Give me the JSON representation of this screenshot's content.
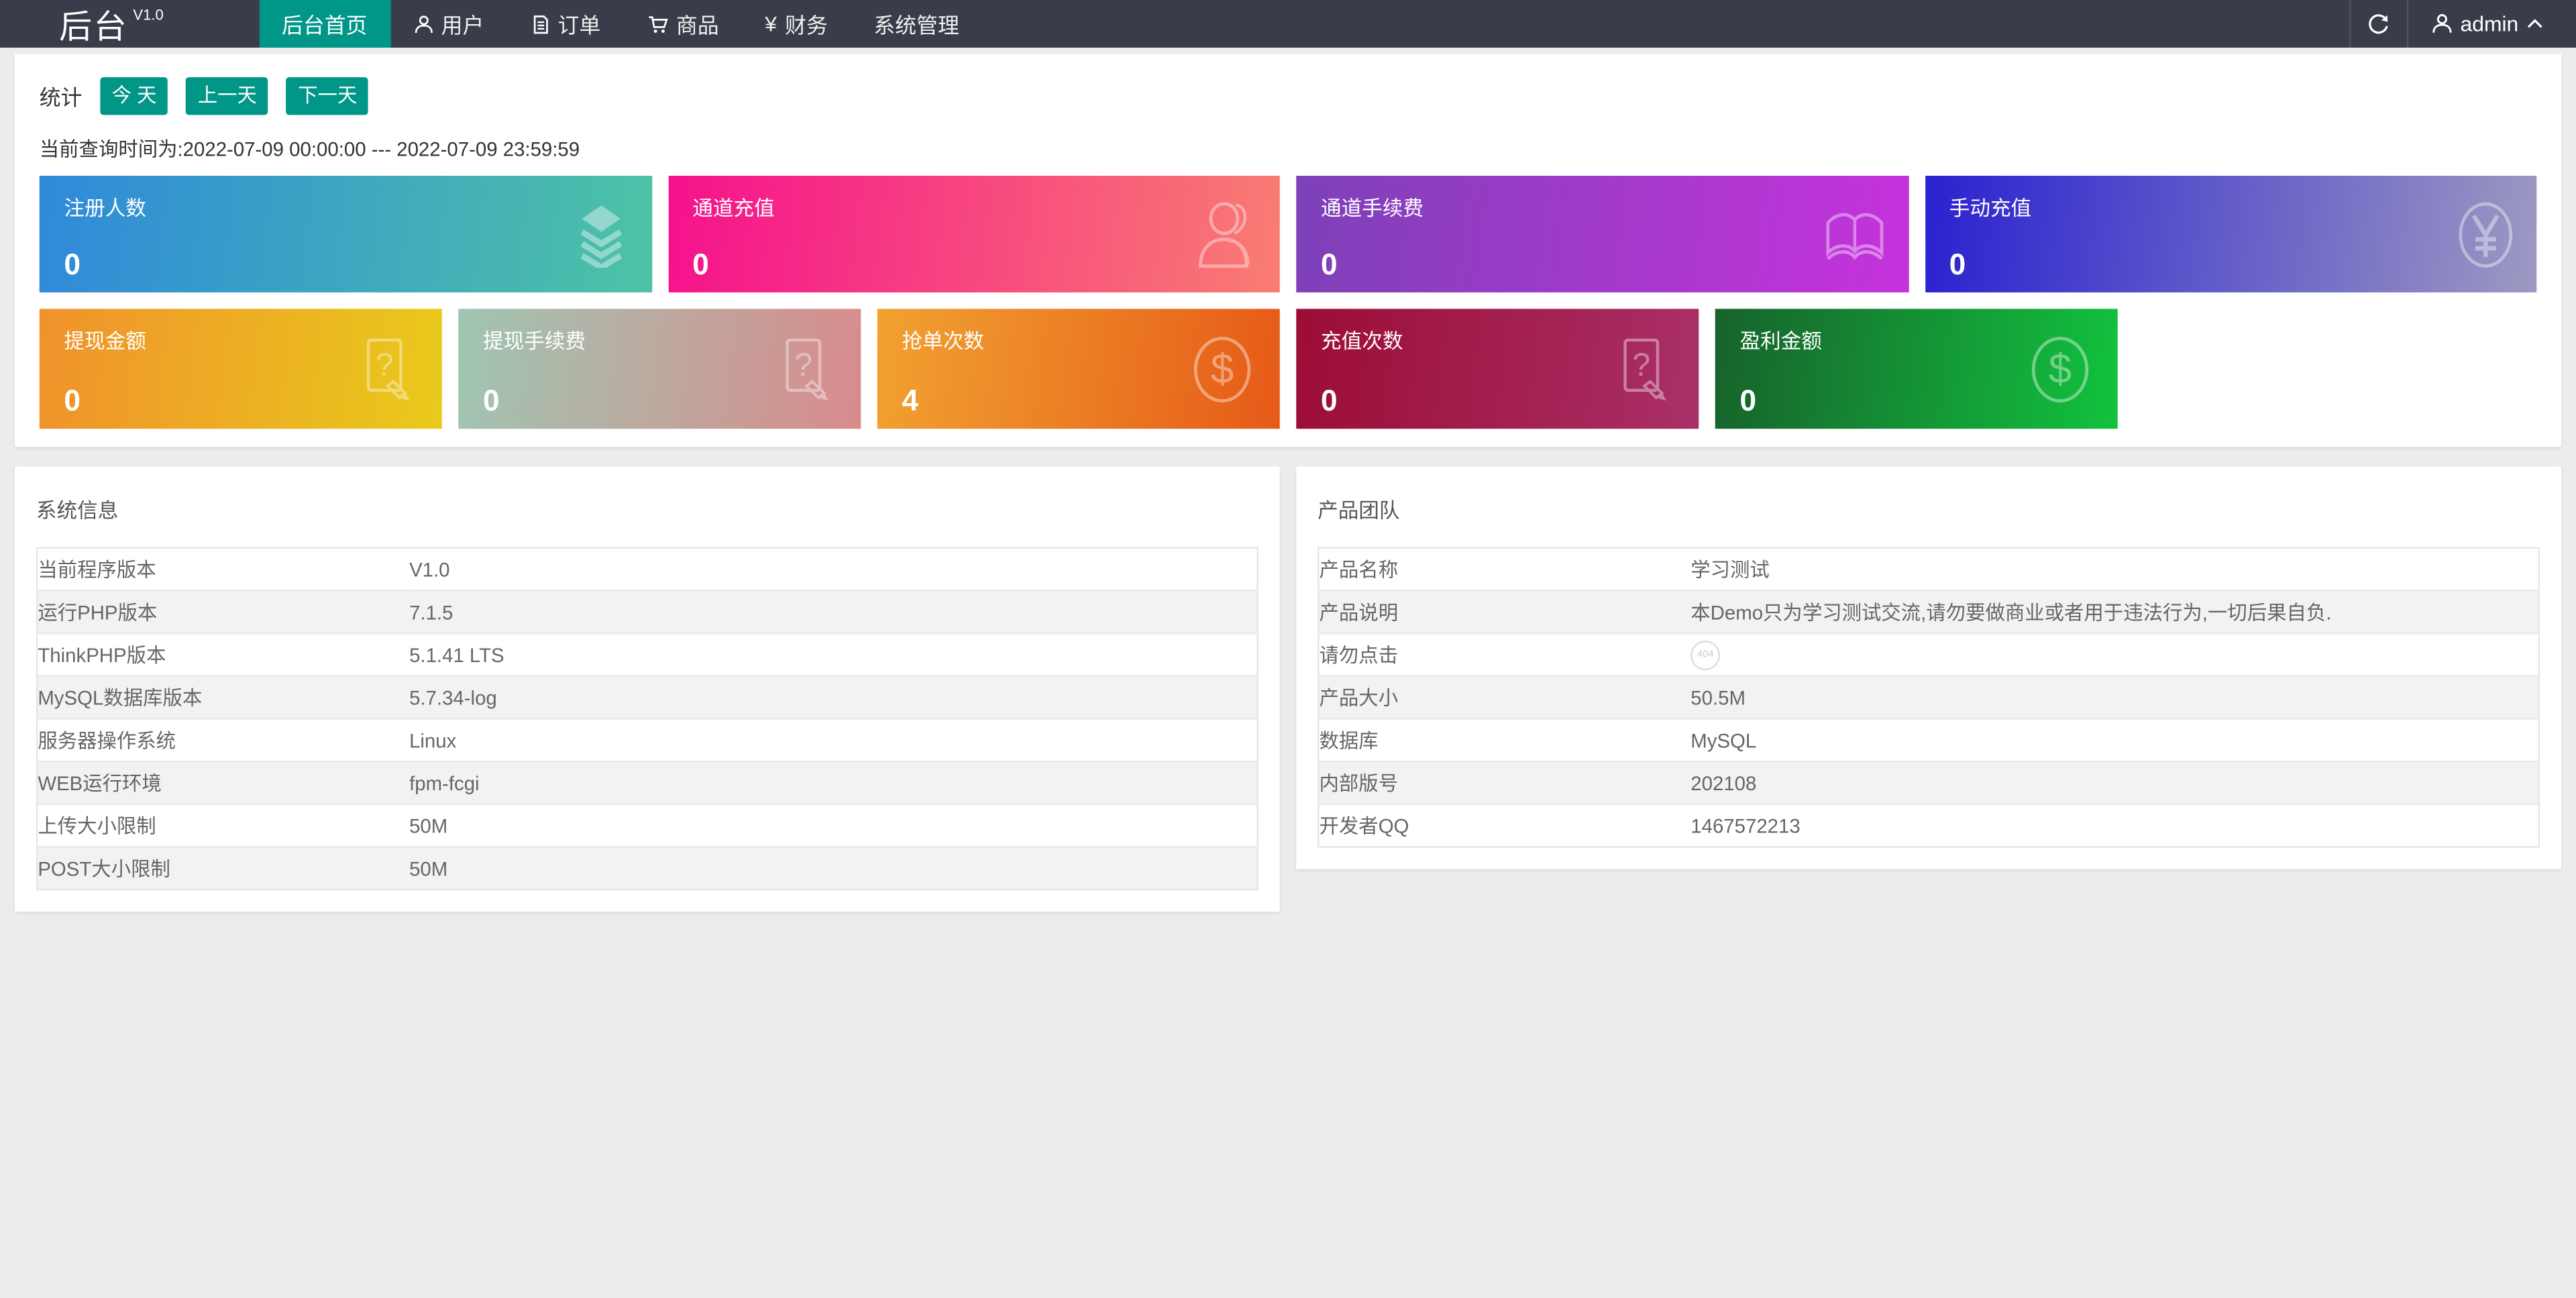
{
  "navbar": {
    "logo": "后台",
    "logo_version": "V1.0",
    "items": [
      {
        "label": "后台首页"
      },
      {
        "label": "用户"
      },
      {
        "label": "订单"
      },
      {
        "label": "商品"
      },
      {
        "label": "财务",
        "icon_glyph": "¥"
      },
      {
        "label": "系统管理"
      }
    ],
    "username": "admin"
  },
  "stats": {
    "section_label": "统计",
    "buttons": [
      {
        "label": "今 天"
      },
      {
        "label": "上一天"
      },
      {
        "label": "下一天"
      }
    ],
    "query_time_text": "当前查询时间为:2022-07-09 00:00:00 --- 2022-07-09 23:59:59",
    "cards_row1": [
      {
        "label": "注册人数",
        "value": "0",
        "icon": "layers-icon",
        "gradient": [
          "#2f89da",
          "#4ec3a6"
        ]
      },
      {
        "label": "通道充值",
        "value": "0",
        "icon": "person-icon",
        "gradient": [
          "#f5118d",
          "#f97d72"
        ]
      },
      {
        "label": "通道手续费",
        "value": "0",
        "icon": "book-icon",
        "gradient": [
          "#7d41b8",
          "#c632dc"
        ]
      },
      {
        "label": "手动充值",
        "value": "0",
        "icon": "yen-circle-icon",
        "gradient": [
          "#2a21d0",
          "#9d99c1"
        ]
      }
    ],
    "cards_row2": [
      {
        "label": "提现金额",
        "value": "0",
        "icon": "question-paper-icon",
        "gradient": [
          "#f0922c",
          "#e9ca1b"
        ]
      },
      {
        "label": "提现手续费",
        "value": "0",
        "icon": "question-paper-icon",
        "gradient": [
          "#9fc6b2",
          "#d98b8c"
        ]
      },
      {
        "label": "抢单次数",
        "value": "4",
        "icon": "dollar-circle-icon",
        "gradient": [
          "#f1a231",
          "#e65a18"
        ]
      },
      {
        "label": "充值次数",
        "value": "0",
        "icon": "question-paper-icon",
        "gradient": [
          "#9c0d35",
          "#a93068"
        ]
      },
      {
        "label": "盈利金额",
        "value": "0",
        "icon": "dollar-circle-icon",
        "gradient": [
          "#17622c",
          "#12c23e"
        ]
      }
    ]
  },
  "system_info": {
    "title": "系统信息",
    "rows": [
      {
        "label": "当前程序版本",
        "value": "V1.0"
      },
      {
        "label": "运行PHP版本",
        "value": "7.1.5"
      },
      {
        "label": "ThinkPHP版本",
        "value": "5.1.41 LTS"
      },
      {
        "label": "MySQL数据库版本",
        "value": "5.7.34-log"
      },
      {
        "label": "服务器操作系统",
        "value": "Linux"
      },
      {
        "label": "WEB运行环境",
        "value": "fpm-fcgi"
      },
      {
        "label": "上传大小限制",
        "value": "50M"
      },
      {
        "label": "POST大小限制",
        "value": "50M"
      }
    ]
  },
  "product_team": {
    "title": "产品团队",
    "rows": [
      {
        "label": "产品名称",
        "value": "学习测试"
      },
      {
        "label": "产品说明",
        "value": "本Demo只为学习测试交流,请勿要做商业或者用于违法行为,一切后果自负."
      },
      {
        "label": "请勿点击",
        "value": ""
      },
      {
        "label": "产品大小",
        "value": "50.5M"
      },
      {
        "label": "数据库",
        "value": "MySQL"
      },
      {
        "label": "内部版号",
        "value": "202108"
      },
      {
        "label": "开发者QQ",
        "value": "1467572213"
      }
    ],
    "badge_text": "404"
  },
  "colors": {
    "navbar_bg": "#393d49",
    "accent_teal": "#009688",
    "page_bg": "#ececec",
    "table_stripe": "#f2f2f2"
  }
}
